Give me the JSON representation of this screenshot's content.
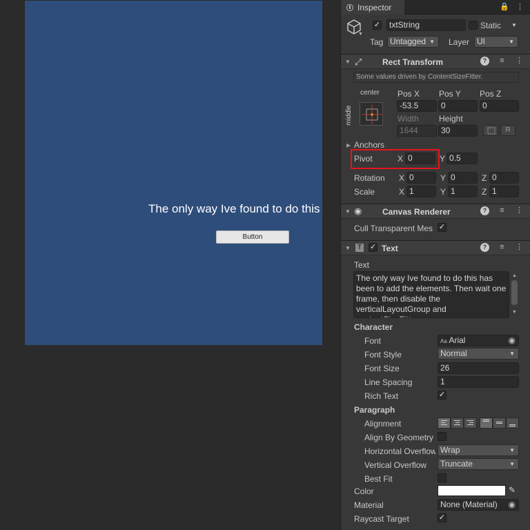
{
  "scene": {
    "text": "The only way Ive found to do this has been to add the elements. Then wait one frame, then disable the verticalLayoutGroup and contentSizeFitter.",
    "button_label": "Button",
    "canvas_color": "#2e4d7a"
  },
  "inspector": {
    "tab_title": "Inspector",
    "object": {
      "active": true,
      "name": "txtString",
      "static_label": "Static",
      "tag_label": "Tag",
      "tag_value": "Untagged",
      "layer_label": "Layer",
      "layer_value": "UI"
    },
    "rect_transform": {
      "title": "Rect Transform",
      "driven_note": "Some values driven by ContentSizeFitter.",
      "anchor_h": "center",
      "anchor_v": "middle",
      "pos_x_label": "Pos X",
      "pos_y_label": "Pos Y",
      "pos_z_label": "Pos Z",
      "pos_x": "-53.5",
      "pos_y": "0",
      "pos_z": "0",
      "width_label": "Width",
      "height_label": "Height",
      "width": "1644",
      "height": "30",
      "r_label": "R",
      "anchors_label": "Anchors",
      "pivot_label": "Pivot",
      "pivot_x": "0",
      "pivot_y": "0.5",
      "rotation_label": "Rotation",
      "rot_x": "0",
      "rot_y": "0",
      "rot_z": "0",
      "scale_label": "Scale",
      "scale_x": "1",
      "scale_y": "1",
      "scale_z": "1",
      "x": "X",
      "y": "Y",
      "z": "Z"
    },
    "canvas_renderer": {
      "title": "Canvas Renderer",
      "cull_label": "Cull Transparent Mes",
      "cull": true
    },
    "text_component": {
      "title": "Text",
      "enabled": true,
      "text_label": "Text",
      "text_value": "The only way Ive found to do this has been to add the elements. Then wait one frame, then disable the verticalLayoutGroup and contentSizeFitter.",
      "character_label": "Character",
      "font_label": "Font",
      "font_value": "Arial",
      "font_style_label": "Font Style",
      "font_style_value": "Normal",
      "font_size_label": "Font Size",
      "font_size_value": "26",
      "line_spacing_label": "Line Spacing",
      "line_spacing_value": "1",
      "rich_text_label": "Rich Text",
      "rich_text": true,
      "paragraph_label": "Paragraph",
      "alignment_label": "Alignment",
      "align_by_geometry_label": "Align By Geometry",
      "h_overflow_label": "Horizontal Overflow",
      "h_overflow_value": "Wrap",
      "v_overflow_label": "Vertical Overflow",
      "v_overflow_value": "Truncate",
      "best_fit_label": "Best Fit",
      "color_label": "Color",
      "color_value": "#ffffff",
      "material_label": "Material",
      "material_value": "None (Material)",
      "raycast_label": "Raycast Target",
      "raycast": true
    }
  }
}
